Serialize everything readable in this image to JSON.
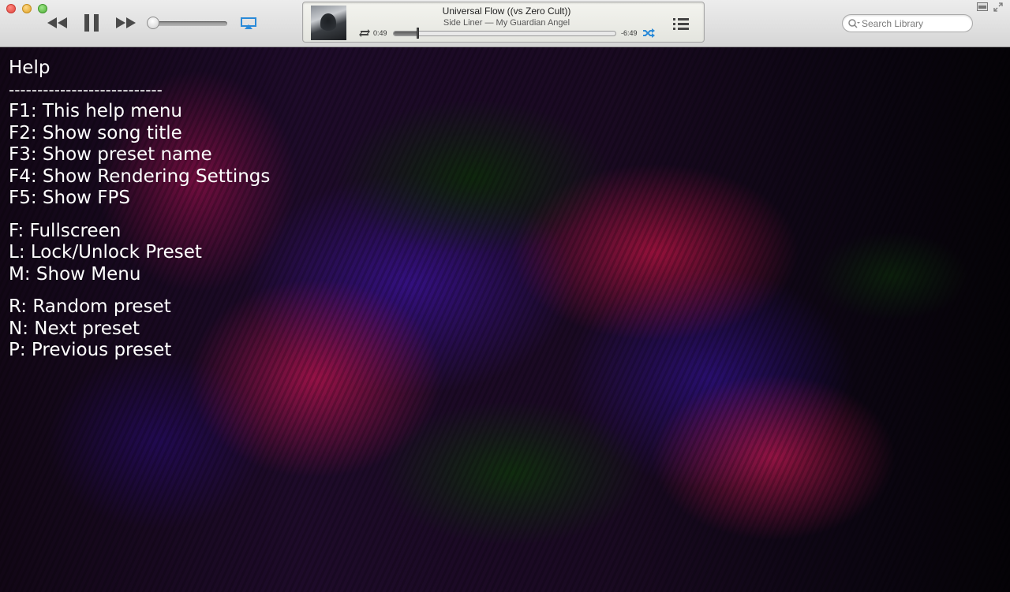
{
  "toolbar": {
    "now_playing": {
      "title": "Universal Flow ((vs Zero Cult))",
      "subtitle": "Side Liner — My Guardian Angel",
      "elapsed": "0:49",
      "remaining": "-6:49",
      "progress": 0.11
    },
    "volume": 0.0,
    "search": {
      "placeholder": "Search Library",
      "value": ""
    }
  },
  "help": {
    "title": "Help",
    "rule": "---------------------------",
    "function_keys": [
      "F1: This help menu",
      "F2: Show song title",
      "F3: Show preset name",
      "F4: Show Rendering Settings",
      "F5: Show FPS"
    ],
    "view_keys": [
      "F: Fullscreen",
      "L: Lock/Unlock Preset",
      "M: Show Menu"
    ],
    "preset_keys": [
      "R: Random preset",
      "N: Next preset",
      "P: Previous preset"
    ]
  },
  "colors": {
    "accent_blue": "#2a8ad8",
    "help_text": "#ffffff"
  }
}
